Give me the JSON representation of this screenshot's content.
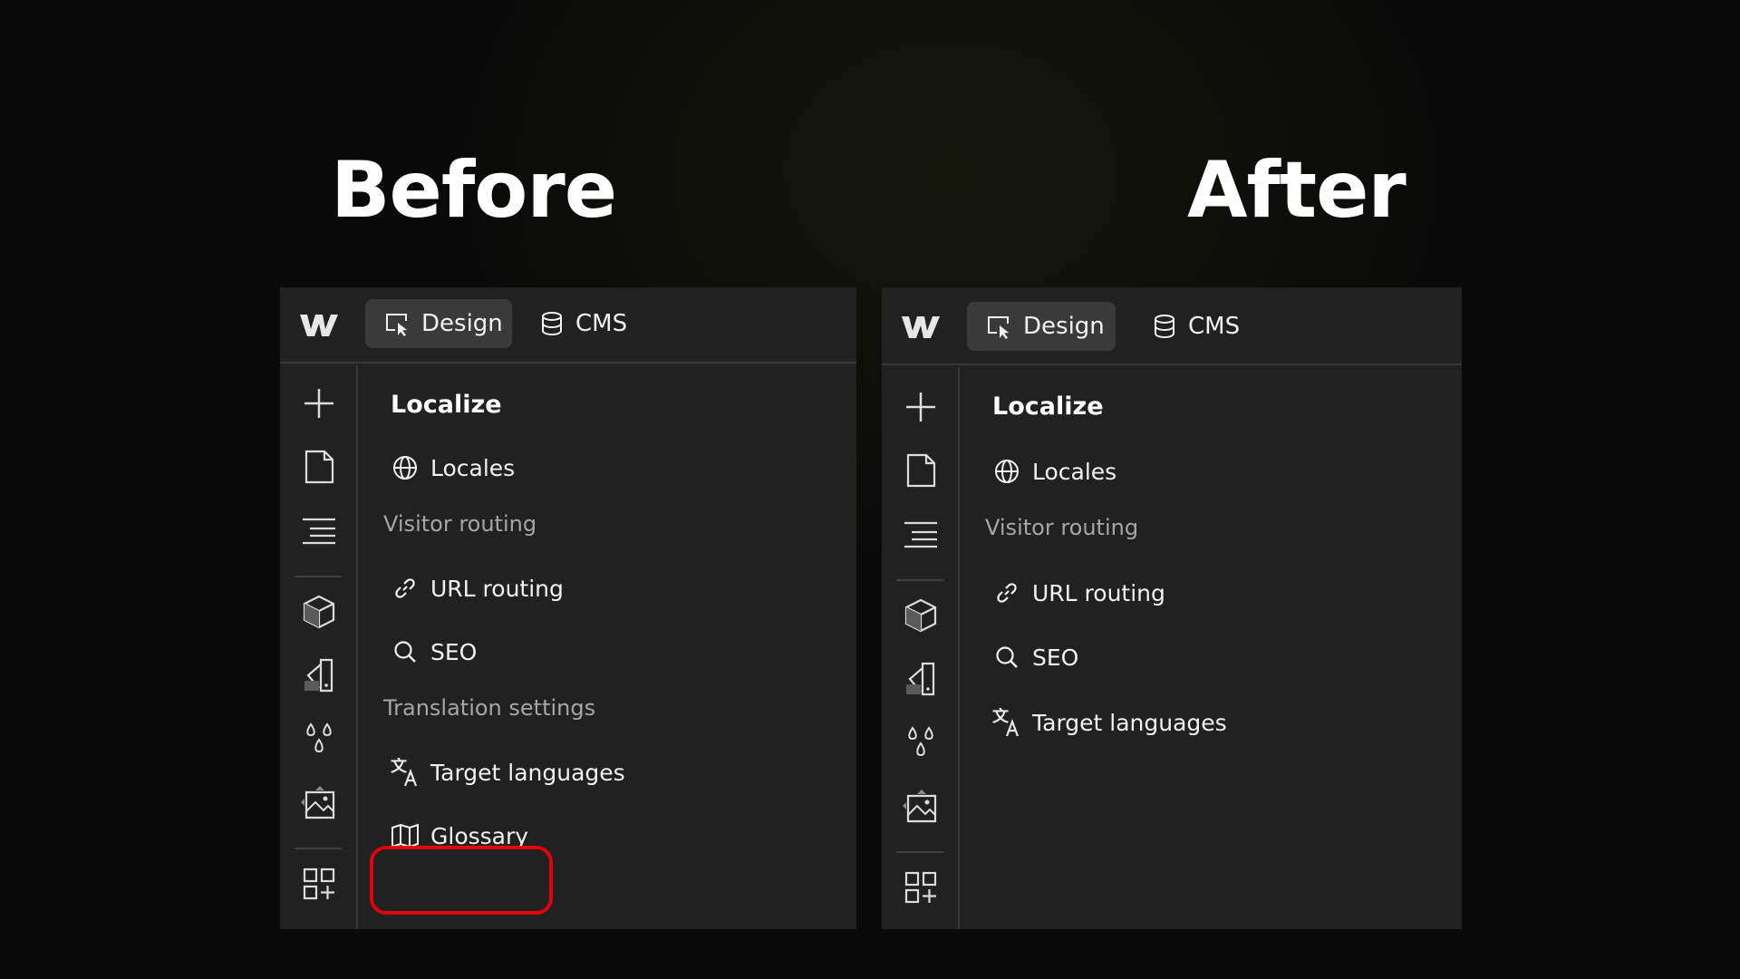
{
  "headings": {
    "before": "Before",
    "after": "After"
  },
  "before": {
    "tabs": [
      {
        "label": "Design",
        "active": true
      },
      {
        "label": "CMS",
        "active": false
      }
    ],
    "panel_title": "Localize",
    "items": {
      "locales": "Locales",
      "visitor_routing_header": "Visitor routing",
      "url_routing": "URL routing",
      "seo": "SEO",
      "translation_settings_header": "Translation settings",
      "target_languages": "Target languages",
      "glossary": "Glossary"
    },
    "highlighted_item": "Glossary"
  },
  "after": {
    "tabs": [
      {
        "label": "Design",
        "active": true
      },
      {
        "label": "CMS",
        "active": false
      }
    ],
    "panel_title": "Localize",
    "items": {
      "locales": "Locales",
      "visitor_routing_header": "Visitor routing",
      "url_routing": "URL routing",
      "seo": "SEO",
      "target_languages": "Target languages"
    }
  },
  "icon_glyphs": {
    "translate": "文"
  },
  "rail_icons": [
    "plus-icon",
    "page-icon",
    "navigator-icon",
    "components-icon",
    "styles-icon",
    "variables-icon",
    "assets-icon",
    "apps-icon"
  ],
  "colors": {
    "panel_bg": "#212121",
    "active_tab_bg": "#3a3a3a",
    "highlight": "#e0000b",
    "muted_text": "#a6a6a6"
  }
}
